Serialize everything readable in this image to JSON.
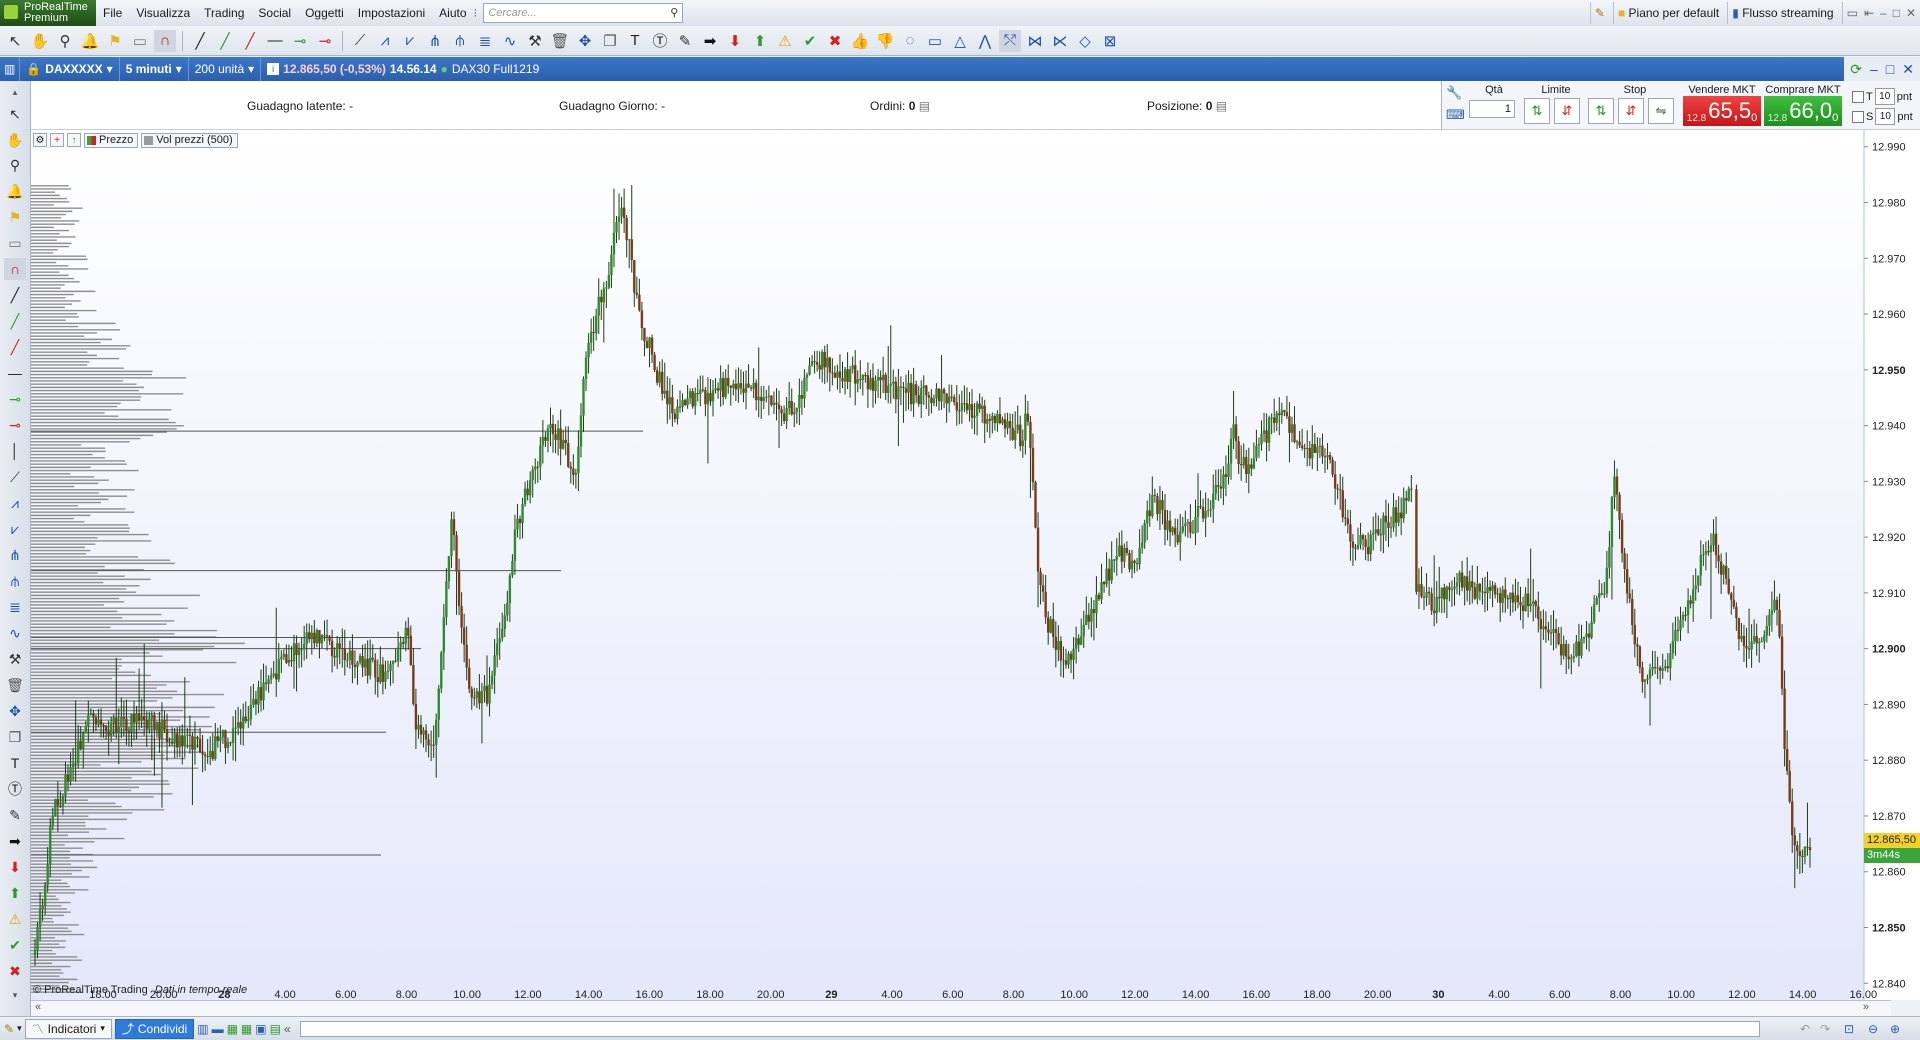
{
  "app": {
    "logo_line1": "ProRealTime",
    "logo_line2": "Premium"
  },
  "menu": [
    "File",
    "Visualizza",
    "Trading",
    "Social",
    "Oggetti",
    "Impostazioni",
    "Aiuto"
  ],
  "search": {
    "placeholder": "Cercare..."
  },
  "header_right": {
    "layout": "Piano per default",
    "streaming": "Flusso streaming"
  },
  "window": {
    "ticker": "DAXXXXX",
    "timeframe": "5 minuti",
    "units": "200 unità",
    "price_change": "12.865,50 (-0,53%)",
    "time": "14.56.14",
    "contract": "DAX30 Full1219"
  },
  "infobar": {
    "latent_label": "Guadagno latente:",
    "latent_value": "-",
    "day_label": "Guadagno Giorno:",
    "day_value": "-",
    "orders_label": "Ordini:",
    "orders_value": "0",
    "position_label": "Posizione:",
    "position_value": "0"
  },
  "order_panel": {
    "qty_label": "Qtà",
    "qty_value": "1",
    "limit_label": "Limite",
    "stop_label": "Stop",
    "sell_label": "Vendere MKT",
    "buy_label": "Comprare MKT",
    "sell_small": "12.8",
    "sell_big": "65,5",
    "sell_sup": "0",
    "buy_small": "12.8",
    "buy_big": "66,0",
    "buy_sup": "0",
    "t_label": "T",
    "s_label": "S",
    "t_value": "10",
    "s_value": "10",
    "unit": "pnt"
  },
  "legend": {
    "price": "Prezzo",
    "volume": "Vol prezzi (500)",
    "price_color": "#3aa33a",
    "volume_color": "#9a9a9a"
  },
  "footer": {
    "credit": "© ProRealTime Trading",
    "realtime": "Dati in tempo reale"
  },
  "bottom": {
    "indicators": "Indicatori",
    "share": "Condividi"
  },
  "colors": {
    "up": "#2e8b2e",
    "down": "#7a3b1a",
    "bg_top": "#ffffff",
    "bg_bottom": "#e3e8fa",
    "last_price_bg": "#f3d12a",
    "timer_bg": "#3aa33a"
  },
  "chart_data": {
    "type": "candlestick",
    "instrument": "DAX30 Full1219",
    "timeframe": "5 minuti",
    "y_ticks": [
      "12.990",
      "12.980",
      "12.970",
      "12.960",
      "12.950",
      "12.940",
      "12.930",
      "12.920",
      "12.910",
      "12.900",
      "12.890",
      "12.880",
      "12.870",
      "12.860",
      "12.850",
      "12.840"
    ],
    "y_bold": [
      "12.950",
      "12.900",
      "12.850"
    ],
    "ylim": [
      12837,
      12993
    ],
    "last_price": "12.865,50",
    "last_price_value": 12865.5,
    "countdown": "3m44s",
    "x_ticks": [
      "18.00",
      "20.00",
      "28",
      "4.00",
      "6.00",
      "8.00",
      "10.00",
      "12.00",
      "14.00",
      "16.00",
      "18.00",
      "20.00",
      "29",
      "4.00",
      "6.00",
      "8.00",
      "10.00",
      "12.00",
      "14.00",
      "16.00",
      "18.00",
      "20.00",
      "30",
      "4.00",
      "6.00",
      "8.00",
      "10.00",
      "12.00",
      "14.00",
      "16.00"
    ],
    "x_bold": [
      "28",
      "29",
      "30"
    ],
    "path": [
      [
        0,
        12845
      ],
      [
        0.01,
        12870
      ],
      [
        0.02,
        12878
      ],
      [
        0.03,
        12888
      ],
      [
        0.04,
        12886
      ],
      [
        0.06,
        12887
      ],
      [
        0.08,
        12884
      ],
      [
        0.1,
        12882
      ],
      [
        0.115,
        12886
      ],
      [
        0.13,
        12894
      ],
      [
        0.14,
        12898
      ],
      [
        0.155,
        12902
      ],
      [
        0.17,
        12900
      ],
      [
        0.185,
        12897
      ],
      [
        0.2,
        12895
      ],
      [
        0.21,
        12903
      ],
      [
        0.215,
        12885
      ],
      [
        0.225,
        12882
      ],
      [
        0.235,
        12925
      ],
      [
        0.24,
        12905
      ],
      [
        0.245,
        12890
      ],
      [
        0.255,
        12892
      ],
      [
        0.265,
        12905
      ],
      [
        0.27,
        12920
      ],
      [
        0.28,
        12932
      ],
      [
        0.29,
        12940
      ],
      [
        0.3,
        12935
      ],
      [
        0.305,
        12930
      ],
      [
        0.31,
        12952
      ],
      [
        0.32,
        12964
      ],
      [
        0.33,
        12978
      ],
      [
        0.335,
        12972
      ],
      [
        0.34,
        12960
      ],
      [
        0.35,
        12950
      ],
      [
        0.36,
        12942
      ],
      [
        0.37,
        12945
      ],
      [
        0.38,
        12946
      ],
      [
        0.395,
        12948
      ],
      [
        0.41,
        12946
      ],
      [
        0.42,
        12941
      ],
      [
        0.43,
        12944
      ],
      [
        0.44,
        12952
      ],
      [
        0.45,
        12950
      ],
      [
        0.47,
        12948
      ],
      [
        0.49,
        12946
      ],
      [
        0.51,
        12945
      ],
      [
        0.53,
        12943
      ],
      [
        0.545,
        12940
      ],
      [
        0.555,
        12938
      ],
      [
        0.56,
        12942
      ],
      [
        0.565,
        12915
      ],
      [
        0.57,
        12905
      ],
      [
        0.58,
        12898
      ],
      [
        0.59,
        12903
      ],
      [
        0.6,
        12910
      ],
      [
        0.61,
        12917
      ],
      [
        0.62,
        12915
      ],
      [
        0.63,
        12928
      ],
      [
        0.64,
        12920
      ],
      [
        0.65,
        12922
      ],
      [
        0.66,
        12925
      ],
      [
        0.67,
        12930
      ],
      [
        0.675,
        12940
      ],
      [
        0.68,
        12932
      ],
      [
        0.69,
        12936
      ],
      [
        0.7,
        12943
      ],
      [
        0.71,
        12938
      ],
      [
        0.72,
        12935
      ],
      [
        0.73,
        12934
      ],
      [
        0.74,
        12920
      ],
      [
        0.75,
        12918
      ],
      [
        0.76,
        12922
      ],
      [
        0.77,
        12925
      ],
      [
        0.775,
        12930
      ],
      [
        0.778,
        12910
      ],
      [
        0.79,
        12908
      ],
      [
        0.8,
        12912
      ],
      [
        0.82,
        12910
      ],
      [
        0.84,
        12908
      ],
      [
        0.855,
        12903
      ],
      [
        0.865,
        12898
      ],
      [
        0.875,
        12903
      ],
      [
        0.885,
        12912
      ],
      [
        0.89,
        12932
      ],
      [
        0.895,
        12915
      ],
      [
        0.905,
        12895
      ],
      [
        0.915,
        12895
      ],
      [
        0.925,
        12902
      ],
      [
        0.935,
        12912
      ],
      [
        0.945,
        12920
      ],
      [
        0.955,
        12910
      ],
      [
        0.96,
        12903
      ],
      [
        0.97,
        12900
      ],
      [
        0.975,
        12905
      ],
      [
        0.982,
        12908
      ],
      [
        0.986,
        12880
      ],
      [
        0.992,
        12862
      ],
      [
        1.0,
        12865.5
      ]
    ],
    "volume_profile": "horizontal volume-at-price bars on the left side (Vol prezzi 500)"
  }
}
